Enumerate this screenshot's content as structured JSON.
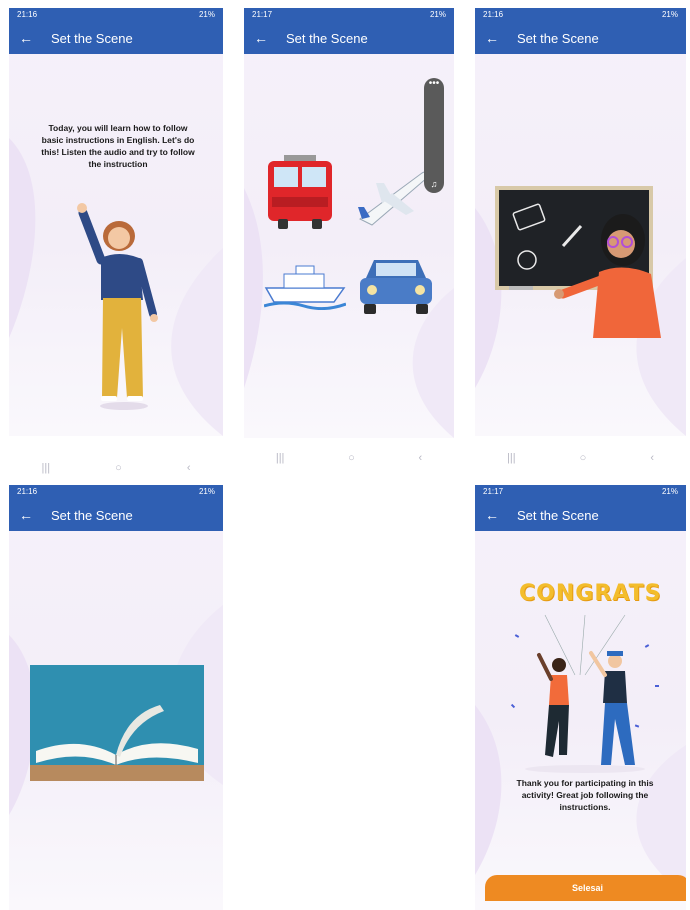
{
  "screens": {
    "s1": {
      "time": "21:16",
      "status_right": "21%",
      "title": "Set the Scene",
      "text": "Today, you will learn how to follow basic instructions in English. Let's do this! Listen the audio and try to follow the instruction"
    },
    "s2": {
      "time": "21:17",
      "status_right": "21%",
      "title": "Set the Scene"
    },
    "s3": {
      "time": "21:16",
      "status_right": "21%",
      "title": "Set the Scene"
    },
    "s4": {
      "time": "21:16",
      "status_right": "21%",
      "title": "Set the Scene"
    },
    "s5": {
      "time": "21:17",
      "status_right": "21%",
      "title": "Set the Scene",
      "congrats": "CONGRATS",
      "text": "Thank you for participating in this activity! Great job following the instructions.",
      "button": "Selesai"
    }
  },
  "nav": {
    "recents": "|||",
    "home": "○",
    "back": "‹"
  },
  "icons": {
    "back": "arrow-left-icon",
    "more": "more-dots-icon",
    "audio": "music-note-icon"
  },
  "colors": {
    "appbar": "#2f5fb3",
    "button": "#ee8a22"
  }
}
